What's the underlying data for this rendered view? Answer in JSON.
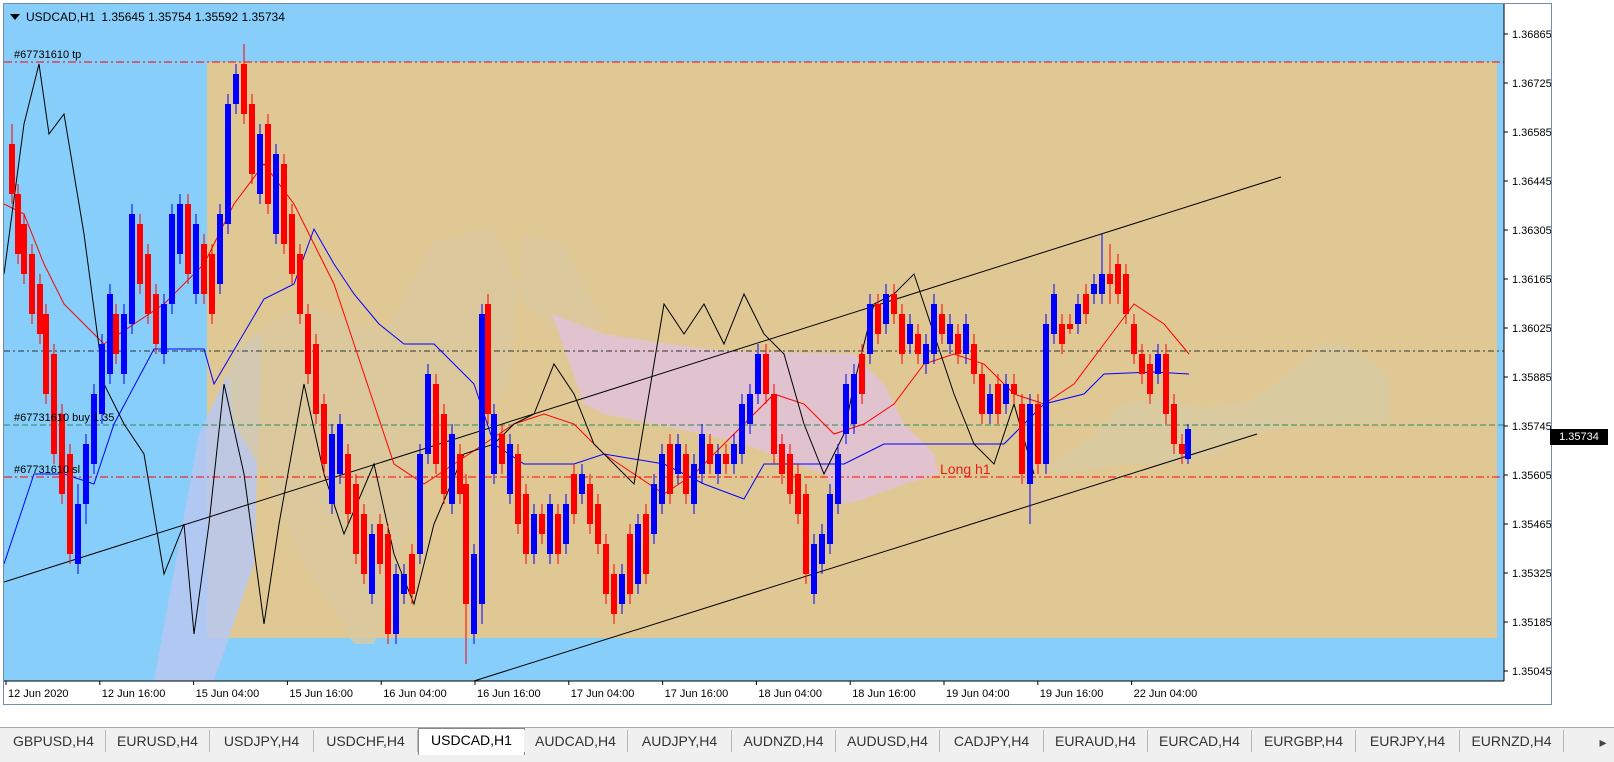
{
  "header": {
    "symbol": "USDCAD,H1",
    "ohlc": "1.35645 1.35754 1.35592 1.35734"
  },
  "price_axis": {
    "labels": [
      "1.36865",
      "1.36725",
      "1.36585",
      "1.36445",
      "1.36305",
      "1.36165",
      "1.36025",
      "1.35885",
      "1.35745",
      "1.35605",
      "1.35465",
      "1.35325",
      "1.35185",
      "1.35045"
    ],
    "current_price": "1.35734"
  },
  "time_axis": {
    "labels": [
      "12 Jun 2020",
      "12 Jun 16:00",
      "15 Jun 04:00",
      "15 Jun 16:00",
      "16 Jun 04:00",
      "16 Jun 16:00",
      "17 Jun 04:00",
      "17 Jun 16:00",
      "18 Jun 04:00",
      "18 Jun 16:00",
      "19 Jun 04:00",
      "19 Jun 16:00",
      "22 Jun 04:00"
    ]
  },
  "order_labels": {
    "tp": "#67731610 tp",
    "buy": "#67731610 buy 1.35",
    "sl": "#67731610 sl"
  },
  "annotation": "Long h1",
  "colors": {
    "sky": "#87cefa",
    "zone": "#e0c894",
    "cloud_green": "#d9caa0",
    "cloud_pink": "#dfc3d2",
    "bull": "#0000ff",
    "bear": "#ff0000",
    "tp_line": "#ff0000",
    "buy_line": "#2e8b57"
  },
  "tabs": [
    {
      "label": "GBPUSD,H4",
      "active": false
    },
    {
      "label": "EURUSD,H4",
      "active": false
    },
    {
      "label": "USDJPY,H4",
      "active": false
    },
    {
      "label": "USDCHF,H4",
      "active": false
    },
    {
      "label": "USDCAD,H1",
      "active": true
    },
    {
      "label": "AUDCAD,H4",
      "active": false
    },
    {
      "label": "AUDJPY,H4",
      "active": false
    },
    {
      "label": "AUDNZD,H4",
      "active": false
    },
    {
      "label": "AUDUSD,H4",
      "active": false
    },
    {
      "label": "CADJPY,H4",
      "active": false
    },
    {
      "label": "EURAUD,H4",
      "active": false
    },
    {
      "label": "EURCAD,H4",
      "active": false
    },
    {
      "label": "EURGBP,H4",
      "active": false
    },
    {
      "label": "EURJPY,H4",
      "active": false
    },
    {
      "label": "EURNZD,H4",
      "active": false
    }
  ]
}
